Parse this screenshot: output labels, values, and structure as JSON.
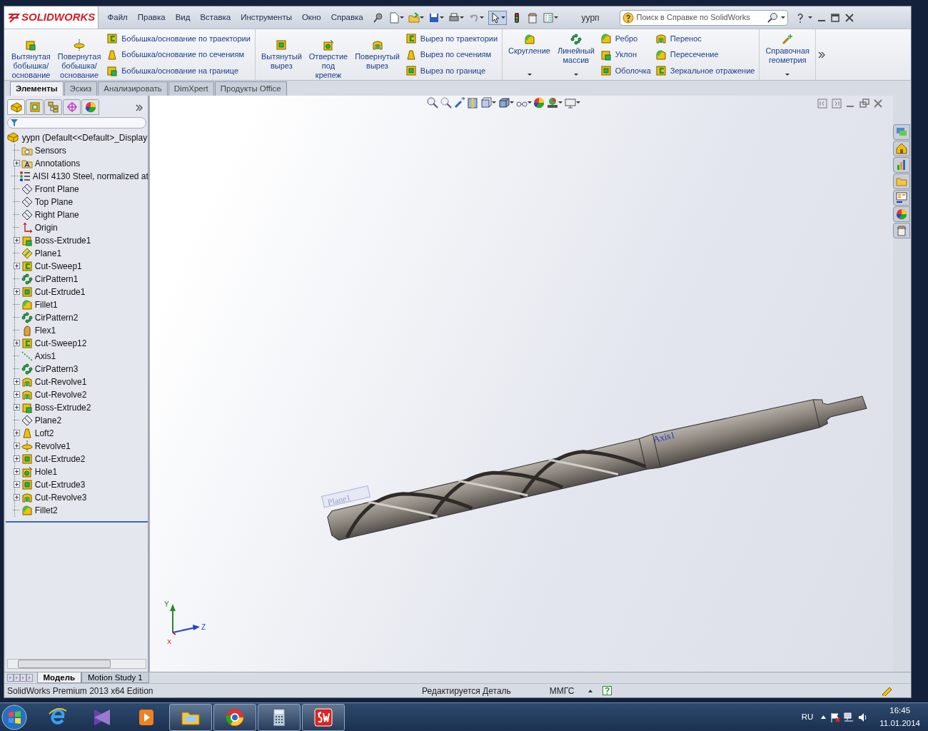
{
  "logo": "SOLIDWORKS",
  "menu": [
    "Файл",
    "Правка",
    "Вид",
    "Вставка",
    "Инструменты",
    "Окно",
    "Справка"
  ],
  "document_title": "уурп",
  "help_search": {
    "placeholder": "Поиск в Справке по SolidWorks"
  },
  "ribbon": [
    {
      "items": [
        {
          "kind": "large",
          "label": "Вытянутая бобышка/основание",
          "dropdown": false
        },
        {
          "kind": "large",
          "label": "Повернутая бобышка/основание",
          "dropdown": false
        },
        {
          "kind": "stack",
          "items": [
            "Бобышка/основание по траектории",
            "Бобышка/основание по сечениям",
            "Бобышка/основание на границе"
          ]
        }
      ]
    },
    {
      "items": [
        {
          "kind": "large",
          "label": "Вытянутый вырез",
          "dropdown": false
        },
        {
          "kind": "large",
          "label": "Отверстие под крепеж",
          "dropdown": false
        },
        {
          "kind": "large",
          "label": "Повернутый вырез",
          "dropdown": false
        },
        {
          "kind": "stack",
          "items": [
            "Вырез по траектории",
            "Вырез по сечениям",
            "Вырез по границе"
          ]
        }
      ]
    },
    {
      "items": [
        {
          "kind": "large",
          "label": "Скругление",
          "dropdown": true
        },
        {
          "kind": "large",
          "label": "Линейный массив",
          "dropdown": true
        },
        {
          "kind": "stack",
          "items": [
            "Ребро",
            "Уклон",
            "Оболочка"
          ]
        },
        {
          "kind": "stack",
          "items": [
            "Перенос",
            "Пересечение",
            "Зеркальное отражение"
          ]
        }
      ]
    },
    {
      "items": [
        {
          "kind": "large",
          "label": "Справочная геометрия",
          "dropdown": true
        }
      ]
    }
  ],
  "command_tabs": [
    {
      "label": "Элементы",
      "selected": true
    },
    {
      "label": "Эскиз",
      "selected": false
    },
    {
      "label": "Анализировать",
      "selected": false
    },
    {
      "label": "DimXpert",
      "selected": false
    },
    {
      "label": "Продукты Office",
      "selected": false
    }
  ],
  "tree": {
    "root": "уурп  (Default<<Default>_Display",
    "items": [
      {
        "label": "Sensors",
        "kind": "folder",
        "has_children": false
      },
      {
        "label": "Annotations",
        "kind": "annotations",
        "has_children": true
      },
      {
        "label": "AISI 4130 Steel, normalized at",
        "kind": "material",
        "has_children": false
      },
      {
        "label": "Front Plane",
        "kind": "plane",
        "has_children": false
      },
      {
        "label": "Top Plane",
        "kind": "plane",
        "has_children": false
      },
      {
        "label": "Right Plane",
        "kind": "plane",
        "has_children": false
      },
      {
        "label": "Origin",
        "kind": "origin",
        "has_children": false
      },
      {
        "label": "Boss-Extrude1",
        "kind": "extrude",
        "has_children": true
      },
      {
        "label": "Plane1",
        "kind": "refplane",
        "has_children": false
      },
      {
        "label": "Cut-Sweep1",
        "kind": "sweep",
        "has_children": true
      },
      {
        "label": "CirPattern1",
        "kind": "pattern",
        "has_children": false
      },
      {
        "label": "Cut-Extrude1",
        "kind": "cut",
        "has_children": true
      },
      {
        "label": "Fillet1",
        "kind": "fillet",
        "has_children": false
      },
      {
        "label": "CirPattern2",
        "kind": "pattern",
        "has_children": false
      },
      {
        "label": "Flex1",
        "kind": "flex",
        "has_children": false
      },
      {
        "label": "Cut-Sweep12",
        "kind": "sweep",
        "has_children": true
      },
      {
        "label": "Axis1",
        "kind": "axis",
        "has_children": false
      },
      {
        "label": "CirPattern3",
        "kind": "pattern",
        "has_children": false
      },
      {
        "label": "Cut-Revolve1",
        "kind": "revolvecut",
        "has_children": true
      },
      {
        "label": "Cut-Revolve2",
        "kind": "revolvecut",
        "has_children": true
      },
      {
        "label": "Boss-Extrude2",
        "kind": "extrude",
        "has_children": true
      },
      {
        "label": "Plane2",
        "kind": "plane",
        "has_children": false
      },
      {
        "label": "Loft2",
        "kind": "loft",
        "has_children": true
      },
      {
        "label": "Revolve1",
        "kind": "revolve",
        "has_children": true
      },
      {
        "label": "Cut-Extrude2",
        "kind": "cut",
        "has_children": true
      },
      {
        "label": "Hole1",
        "kind": "hole",
        "has_children": true
      },
      {
        "label": "Cut-Extrude3",
        "kind": "cut",
        "has_children": true
      },
      {
        "label": "Cut-Revolve3",
        "kind": "revolvecut",
        "has_children": true
      },
      {
        "label": "Fillet2",
        "kind": "fillet",
        "has_children": false
      }
    ]
  },
  "viewport": {
    "axis_label": "Axis1",
    "plane_label": "Plane1",
    "triad": {
      "y": "Y",
      "z": "Z",
      "x": "X"
    }
  },
  "bottom_tabs": [
    {
      "label": "Модель",
      "selected": true
    },
    {
      "label": "Motion Study 1",
      "selected": false
    }
  ],
  "status_bar": {
    "edition": "SolidWorks Premium 2013 x64 Edition",
    "editing": "Редактируется Деталь",
    "units": "ММГС"
  },
  "taskbar": {
    "apps": [
      {
        "running": false
      },
      {
        "running": false
      },
      {
        "running": false
      },
      {
        "running": true
      },
      {
        "running": true
      },
      {
        "running": true
      },
      {
        "running": true
      }
    ],
    "language": "RU",
    "time": "16:45",
    "date": "11.01.2014"
  }
}
